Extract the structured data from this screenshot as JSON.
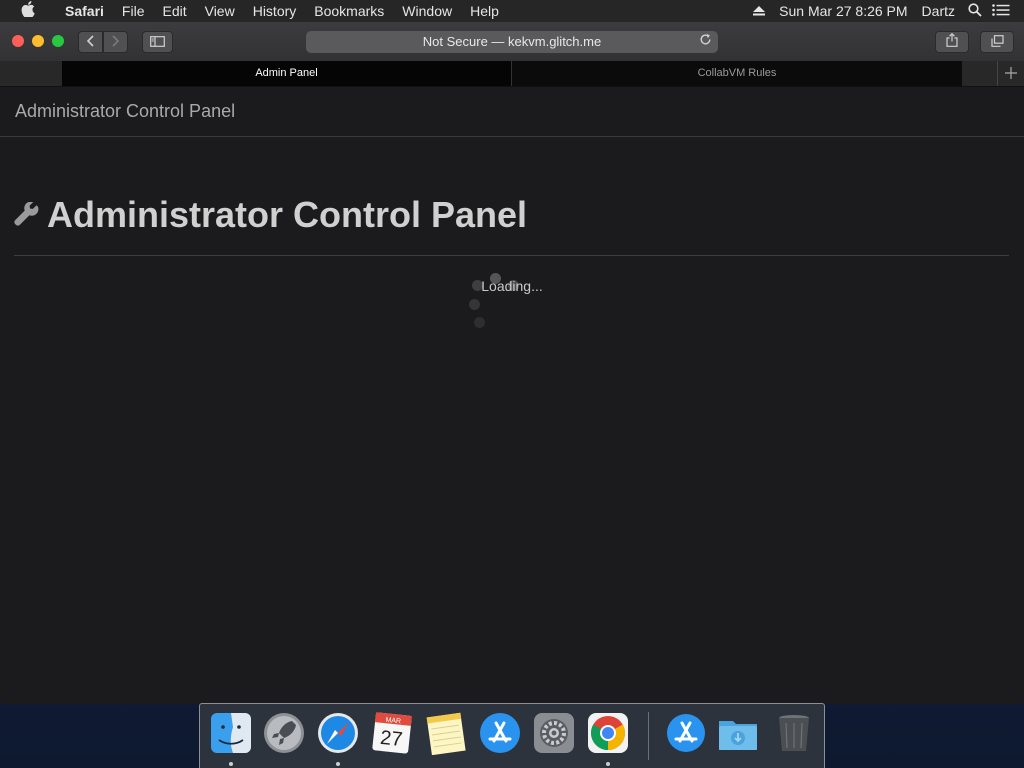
{
  "menubar": {
    "apple_icon": "apple-icon",
    "app_name": "Safari",
    "items": [
      "File",
      "Edit",
      "View",
      "History",
      "Bookmarks",
      "Window",
      "Help"
    ],
    "datetime": "Sun Mar 27  8:26 PM",
    "user": "Dartz"
  },
  "toolbar": {
    "address": "Not Secure — kekvm.glitch.me"
  },
  "tabs": [
    {
      "label": "Admin Panel",
      "active": true
    },
    {
      "label": "CollabVM Rules",
      "active": false
    }
  ],
  "page": {
    "brand": "Administrator Control Panel",
    "heading": "Administrator Control Panel",
    "loading_text": "Loading..."
  },
  "dock": {
    "apps": [
      "Finder",
      "Launchpad",
      "Safari",
      "Calendar",
      "Notes",
      "App Store",
      "System Preferences",
      "Google Chrome",
      "App Store Downloads",
      "Downloads",
      "Trash"
    ],
    "calendar_month": "MAR",
    "calendar_day": "27"
  },
  "colors": {
    "accent_blue": "#1e88e5",
    "background": "#1b1b1d",
    "close": "#fe5f57",
    "minimize": "#febc2e",
    "maximize": "#28c840"
  }
}
